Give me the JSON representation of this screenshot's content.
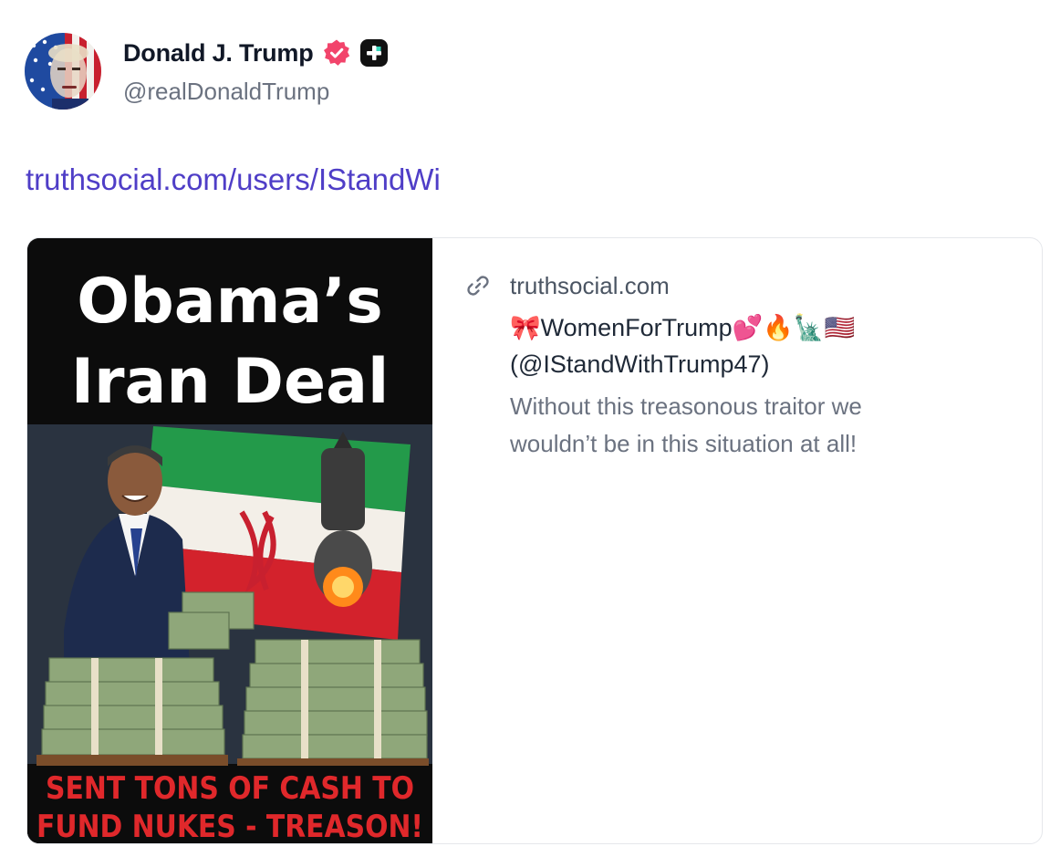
{
  "author": {
    "display_name": "Donald J. Trump",
    "handle": "@realDonaldTrump",
    "verified_icon": "verified-badge-icon",
    "plus_icon": "plus-badge-icon",
    "verified_color": "#f2446b"
  },
  "post": {
    "link_text": "truthsocial.com/users/IStandWi",
    "link_color": "#4f3ec7"
  },
  "card": {
    "domain": "truthsocial.com",
    "link_icon": "link-icon",
    "title": "🎀WomenForTrump💕🔥🗽🇺🇸\n(@IStandWithTrump47)",
    "description": "Without this treasonous traitor we wouldn’t be in this situation at all!",
    "image": {
      "headline_line1": "Obama’s",
      "headline_line2": "Iran Deal",
      "caption_line1": "SENT TONS OF CASH TO",
      "caption_line2": "FUND NUKES - TREASON!",
      "caption_color": "#e0282b"
    }
  }
}
